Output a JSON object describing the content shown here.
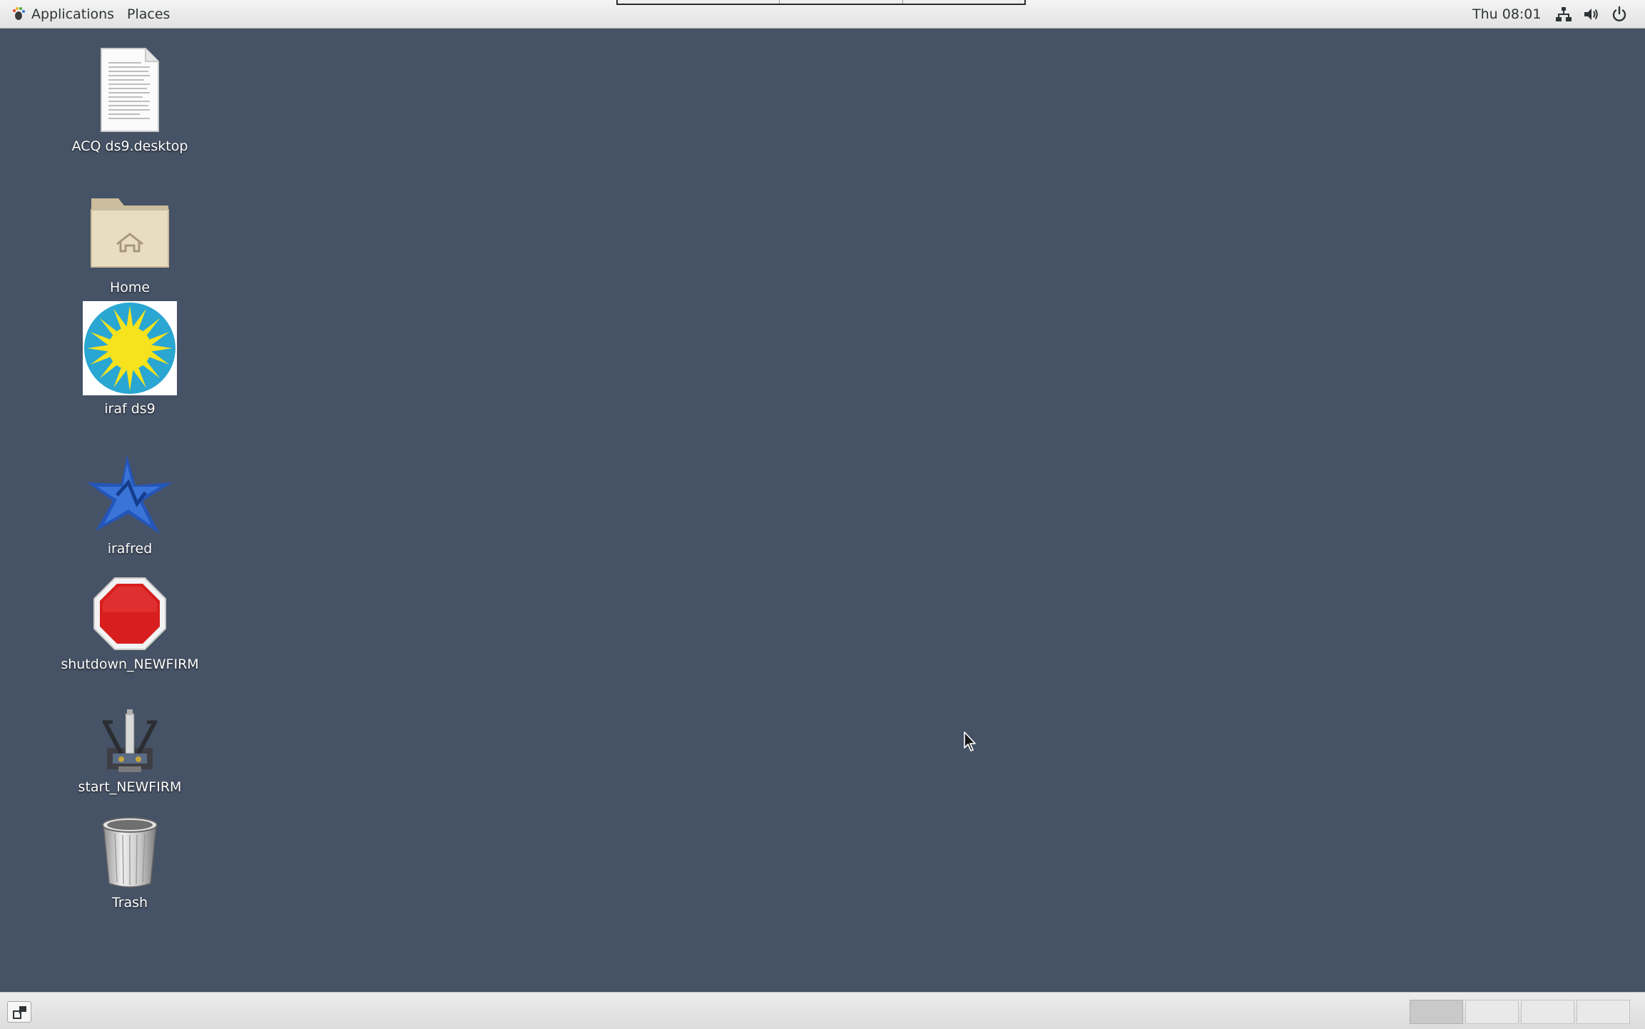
{
  "top_panel": {
    "applications_label": "Applications",
    "places_label": "Places",
    "clock": "Thu 08:01"
  },
  "desktop": {
    "background_color": "#465265",
    "icons": [
      {
        "label": "ACQ ds9.desktop",
        "icon": "text-document-icon"
      },
      {
        "label": "Home",
        "icon": "home-folder-icon"
      },
      {
        "label": "iraf ds9",
        "icon": "ds9-sun-icon"
      },
      {
        "label": "irafred",
        "icon": "iraf-star-icon"
      },
      {
        "label": "shutdown_NEWFIRM",
        "icon": "stop-sign-icon"
      },
      {
        "label": "start_NEWFIRM",
        "icon": "telescope-icon"
      },
      {
        "label": "Trash",
        "icon": "trash-icon"
      }
    ]
  },
  "bottom_panel": {
    "workspaces": [
      {
        "active": true
      },
      {
        "active": false
      },
      {
        "active": false
      },
      {
        "active": false
      }
    ]
  }
}
